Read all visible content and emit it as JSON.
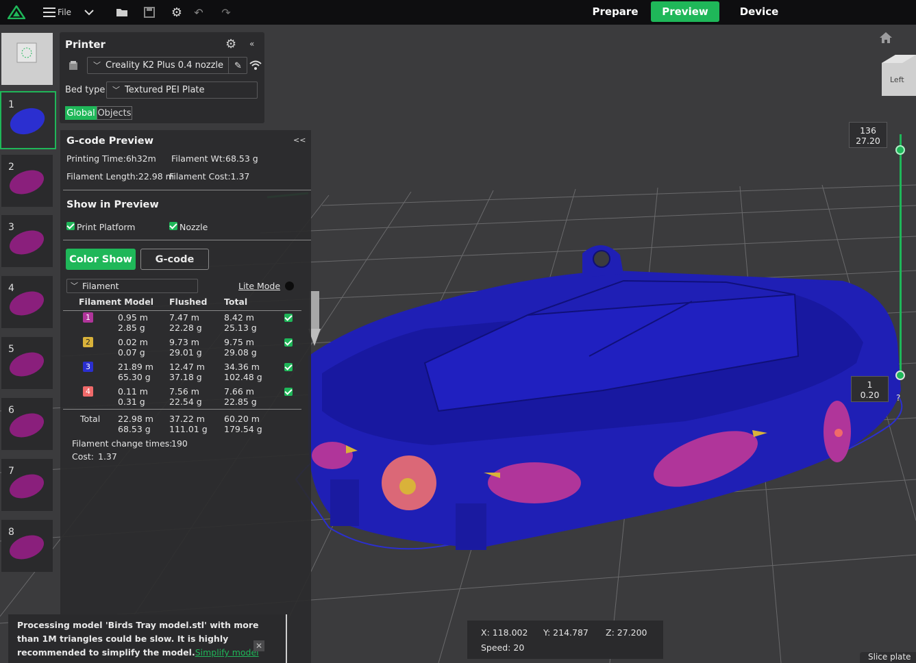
{
  "topbar": {
    "file_label": "File",
    "tabs": [
      {
        "label": "Prepare",
        "active": false
      },
      {
        "label": "Preview",
        "active": true
      },
      {
        "label": "Device",
        "active": false
      }
    ],
    "accent_color": "#1fb759"
  },
  "plates": [
    "1",
    "2",
    "3",
    "4",
    "5",
    "6",
    "7",
    "8"
  ],
  "printer": {
    "title": "Printer",
    "printer_name": "Creality K2 Plus 0.4 nozzle",
    "bed_type_label": "Bed type",
    "bed_type": "Textured PEI Plate",
    "scope_tabs": [
      "Global",
      "Objects"
    ]
  },
  "gcode_preview": {
    "title": "G-code Preview",
    "collapse": "<<",
    "printing_time": "Printing Time:6h32m",
    "filament_wt": "Filament Wt:68.53 g",
    "filament_length": "Filament Length:22.98 m",
    "filament_cost": "Filament Cost:1.37",
    "show_title": "Show in Preview",
    "show_print_platform": "Print Platform",
    "show_nozzle": "Nozzle",
    "color_show_btn": "Color Show",
    "gcode_btn": "G-code",
    "filament_dropdown": "Filament",
    "lite_mode": "Lite Mode",
    "table_headers": [
      "Filament Model",
      "Flushed",
      "Total"
    ],
    "filaments": [
      {
        "id": "1",
        "color": "#b0359a",
        "model_m": "0.95 m",
        "model_g": "2.85 g",
        "flushed_m": "7.47 m",
        "flushed_g": "22.28 g",
        "total_m": "8.42 m",
        "total_g": "25.13 g"
      },
      {
        "id": "2",
        "color": "#d9b23a",
        "model_m": "0.02 m",
        "model_g": "0.07 g",
        "flushed_m": "9.73 m",
        "flushed_g": "29.01 g",
        "total_m": "9.75 m",
        "total_g": "29.08 g"
      },
      {
        "id": "3",
        "color": "#2b2fd0",
        "model_m": "21.89 m",
        "model_g": "65.30 g",
        "flushed_m": "12.47 m",
        "flushed_g": "37.18 g",
        "total_m": "34.36 m",
        "total_g": "102.48 g"
      },
      {
        "id": "4",
        "color": "#f06a6a",
        "model_m": "0.11 m",
        "model_g": "0.31 g",
        "flushed_m": "7.56 m",
        "flushed_g": "22.54 g",
        "total_m": "7.66 m",
        "total_g": "22.85 g"
      }
    ],
    "total_label": "Total",
    "total": {
      "model_m": "22.98 m",
      "model_g": "68.53 g",
      "flushed_m": "37.22 m",
      "flushed_g": "111.01 g",
      "total_m": "60.20 m",
      "total_g": "179.54 g"
    },
    "change_times_label": "Filament change times:",
    "change_times": "190",
    "cost_label": "Cost:",
    "cost": "1.37"
  },
  "layer_slider": {
    "top_layer": "136",
    "top_height": "27.20",
    "bottom_layer": "1",
    "bottom_height": "0.20"
  },
  "view_cube_label": "Left",
  "coords": {
    "x": "X: 118.002",
    "y": "Y: 214.787",
    "z": "Z: 27.200",
    "speed": "Speed: 20"
  },
  "notification": {
    "text": "Processing model 'Birds Tray model.stl' with more than 1M triangles could be slow. It is highly recommended to simplify the model.",
    "link": "Simplify model"
  },
  "slice_plate": "Slice plate",
  "help_label": "?"
}
